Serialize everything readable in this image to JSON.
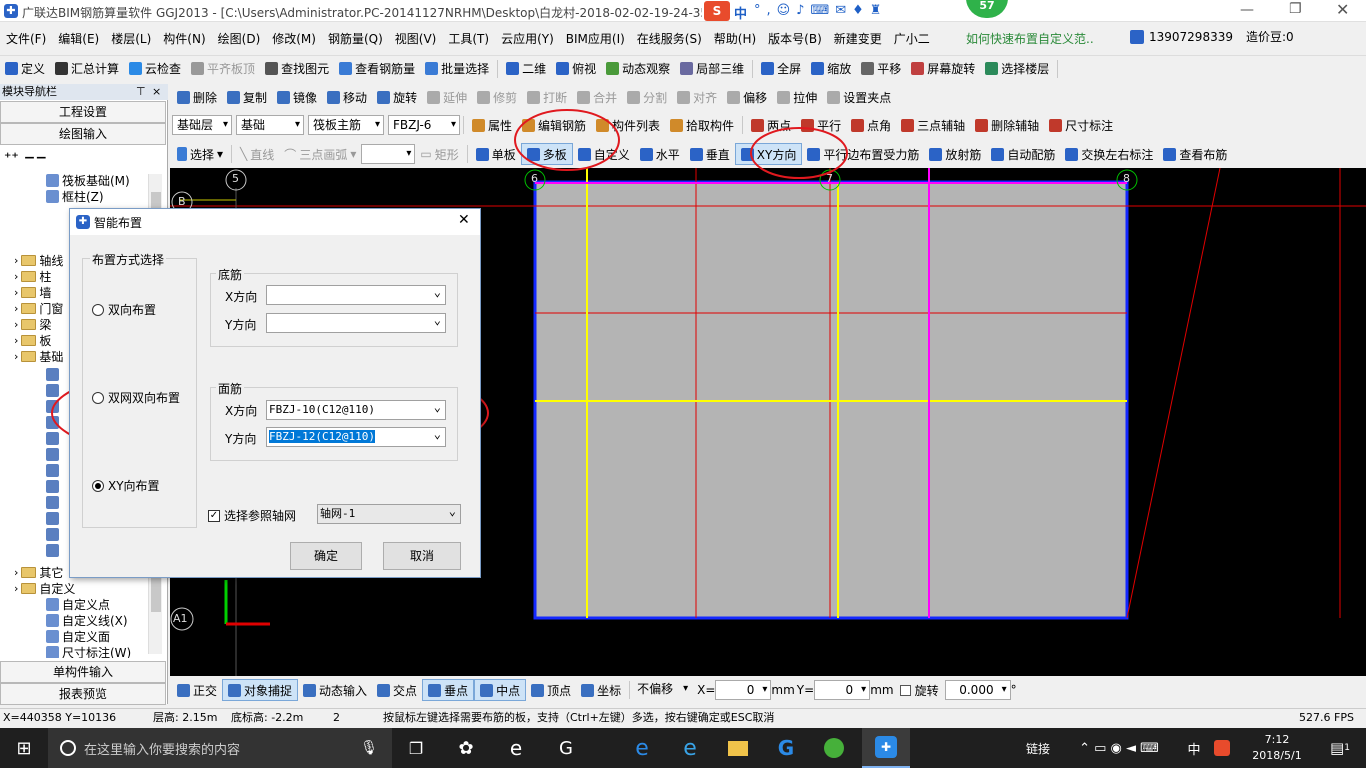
{
  "window": {
    "title": "广联达BIM钢筋算量软件 GGJ2013 - [C:\\Users\\Administrator.PC-20141127NRHM\\Desktop\\白龙村-2018-02-02-19-24-35",
    "notify_count": "57",
    "ime_label": "中",
    "help_prompt": "如何快速布置自定义范..",
    "phone": "13907298339",
    "price_label": "造价豆:0"
  },
  "menu": [
    "文件(F)",
    "编辑(E)",
    "楼层(L)",
    "构件(N)",
    "绘图(D)",
    "修改(M)",
    "钢筋量(Q)",
    "视图(V)",
    "工具(T)",
    "云应用(Y)",
    "BIM应用(I)",
    "在线服务(S)",
    "帮助(H)",
    "版本号(B)",
    "新建变更",
    "广小二"
  ],
  "toolbar1": [
    "定义",
    "汇总计算",
    "云检查",
    "平齐板顶",
    "查找图元",
    "查看钢筋量",
    "批量选择",
    "二维",
    "俯视",
    "动态观察",
    "局部三维",
    "全屏",
    "缩放",
    "平移",
    "屏幕旋转",
    "选择楼层"
  ],
  "toolbar2": [
    "删除",
    "复制",
    "镜像",
    "移动",
    "旋转",
    "延伸",
    "修剪",
    "打断",
    "合并",
    "分割",
    "对齐",
    "偏移",
    "拉伸",
    "设置夹点"
  ],
  "toolbar3": {
    "floor": "基础层",
    "category": "基础",
    "component": "筏板主筋",
    "code": "FBZJ-6",
    "items": [
      "属性",
      "编辑钢筋",
      "构件列表",
      "拾取构件"
    ],
    "aux": [
      "两点",
      "平行",
      "点角",
      "三点辅轴",
      "删除辅轴",
      "尺寸标注"
    ]
  },
  "toolbar4": {
    "select": "选择",
    "line": "直线",
    "arc": "三点画弧",
    "rect": "矩形",
    "items": [
      "单板",
      "多板",
      "自定义",
      "水平",
      "垂直",
      "XY方向",
      "平行边布置受力筋",
      "放射筋",
      "自动配筋",
      "交换左右标注",
      "查看布筋"
    ]
  },
  "nav": {
    "title": "模块导航栏",
    "project_settings": "工程设置",
    "drawing_input": "绘图输入",
    "single_input": "单构件输入",
    "report_preview": "报表预览",
    "tree": [
      "筏板基础(M)",
      "框柱(Z)",
      "轴线",
      "柱",
      "墙",
      "门窗",
      "梁",
      "板",
      "基础",
      "其它",
      "自定义",
      "自定义点",
      "自定义线(X)",
      "自定义面",
      "尺寸标注(W)"
    ]
  },
  "dialog": {
    "title": "智能布置",
    "group_method": "布置方式选择",
    "radio_two_way": "双向布置",
    "radio_double_net": "双网双向布置",
    "radio_xy": "XY向布置",
    "bottom_label": "底筋",
    "top_label": "面筋",
    "x_dir": "X方向",
    "y_dir": "Y方向",
    "bottom_x": "",
    "bottom_y": "",
    "top_x": "FBZJ-10(C12@110)",
    "top_y": "FBZJ-12(C12@110)",
    "ref_axis_label": "选择参照轴网",
    "ref_axis_value": "轴网-1",
    "ok": "确定",
    "cancel": "取消"
  },
  "canvas": {
    "axis_labels": [
      "5",
      "B",
      "6",
      "7",
      "8",
      "A1"
    ]
  },
  "snapbar": {
    "items": [
      "正交",
      "对象捕捉",
      "动态输入",
      "交点",
      "垂点",
      "中点",
      "顶点",
      "坐标"
    ],
    "offset": "不偏移",
    "x_label": "X=",
    "x_val": "0",
    "y_label": "Y=",
    "y_val": "0",
    "unit": "mm",
    "rotate_label": "旋转",
    "rotate_val": "0.000",
    "degree": "°"
  },
  "status": {
    "coords": "X=440358  Y=10136",
    "floor_height": "层高: 2.15m",
    "bottom_elev": "底标高: -2.2m",
    "num": "2",
    "hint": "按鼠标左键选择需要布筋的板，支持（Ctrl+左键）多选，按右键确定或ESC取消",
    "fps": "527.6 FPS"
  },
  "taskbar": {
    "search_placeholder": "在这里输入你要搜索的内容",
    "link": "链接",
    "ime": "中",
    "time": "7:12",
    "date": "2018/5/1",
    "notif_count": "1"
  },
  "colors": {
    "accent": "#2b63c6",
    "highlight_circle": "#e0191f",
    "canvas_bg": "#000000",
    "slab": "#b4b4b4"
  }
}
